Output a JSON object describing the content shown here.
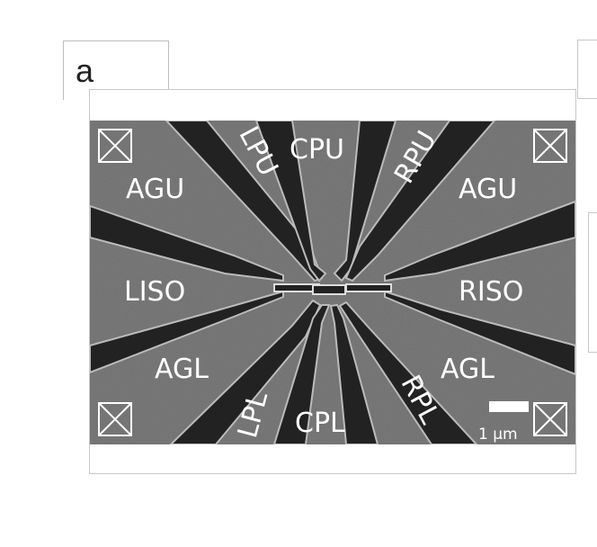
{
  "panel_label": "a",
  "image": {
    "description_labels": {
      "top_center": "CPU",
      "top_left_probe": "LPU",
      "top_right_probe": "RPU",
      "upper_left_gate": "AGU",
      "upper_right_gate": "AGU",
      "left_iso": "LISO",
      "right_iso": "RISO",
      "lower_left_gate": "AGL",
      "lower_right_gate": "AGL",
      "bottom_left_probe": "LPL",
      "bottom_center": "CPL",
      "bottom_right_probe": "RPL"
    },
    "scale_bar": "1 μm"
  }
}
